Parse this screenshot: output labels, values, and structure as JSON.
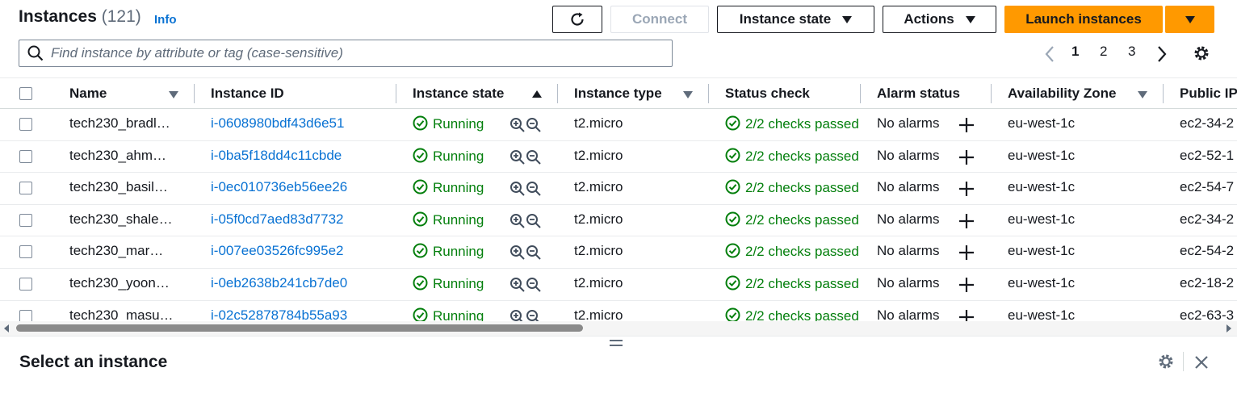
{
  "header": {
    "title": "Instances",
    "count": "(121)",
    "info": "Info",
    "refresh_icon": "refresh-icon",
    "connect": "Connect",
    "instance_state": "Instance state",
    "actions": "Actions",
    "launch": "Launch instances"
  },
  "search": {
    "placeholder": "Find instance by attribute or tag (case-sensitive)"
  },
  "pagination": {
    "pages": [
      "1",
      "2",
      "3"
    ],
    "current": "1"
  },
  "table": {
    "columns": [
      "Name",
      "Instance ID",
      "Instance state",
      "Instance type",
      "Status check",
      "Alarm status",
      "Availability Zone",
      "Public IP"
    ],
    "rows": [
      {
        "name": "tech230_bradl…",
        "id": "i-0608980bdf43d6e51",
        "state": "Running",
        "type": "t2.micro",
        "status": "2/2 checks passed",
        "alarm": "No alarms",
        "az": "eu-west-1c",
        "public": "ec2-34-2"
      },
      {
        "name": "tech230_ahm…",
        "id": "i-0ba5f18dd4c11cbde",
        "state": "Running",
        "type": "t2.micro",
        "status": "2/2 checks passed",
        "alarm": "No alarms",
        "az": "eu-west-1c",
        "public": "ec2-52-1"
      },
      {
        "name": "tech230_basil…",
        "id": "i-0ec010736eb56ee26",
        "state": "Running",
        "type": "t2.micro",
        "status": "2/2 checks passed",
        "alarm": "No alarms",
        "az": "eu-west-1c",
        "public": "ec2-54-7"
      },
      {
        "name": "tech230_shale…",
        "id": "i-05f0cd7aed83d7732",
        "state": "Running",
        "type": "t2.micro",
        "status": "2/2 checks passed",
        "alarm": "No alarms",
        "az": "eu-west-1c",
        "public": "ec2-34-2"
      },
      {
        "name": "tech230_mar…",
        "id": "i-007ee03526fc995e2",
        "state": "Running",
        "type": "t2.micro",
        "status": "2/2 checks passed",
        "alarm": "No alarms",
        "az": "eu-west-1c",
        "public": "ec2-54-2"
      },
      {
        "name": "tech230_yoon…",
        "id": "i-0eb2638b241cb7de0",
        "state": "Running",
        "type": "t2.micro",
        "status": "2/2 checks passed",
        "alarm": "No alarms",
        "az": "eu-west-1c",
        "public": "ec2-18-2"
      },
      {
        "name": "tech230_masu…",
        "id": "i-02c52878784b55a93",
        "state": "Running",
        "type": "t2.micro",
        "status": "2/2 checks passed",
        "alarm": "No alarms",
        "az": "eu-west-1c",
        "public": "ec2-63-3"
      }
    ]
  },
  "bottom_panel": {
    "title": "Select an instance"
  },
  "colors": {
    "primary": "#ff9900",
    "link": "#0972d3",
    "success": "#037f0c",
    "text": "#16191f"
  }
}
